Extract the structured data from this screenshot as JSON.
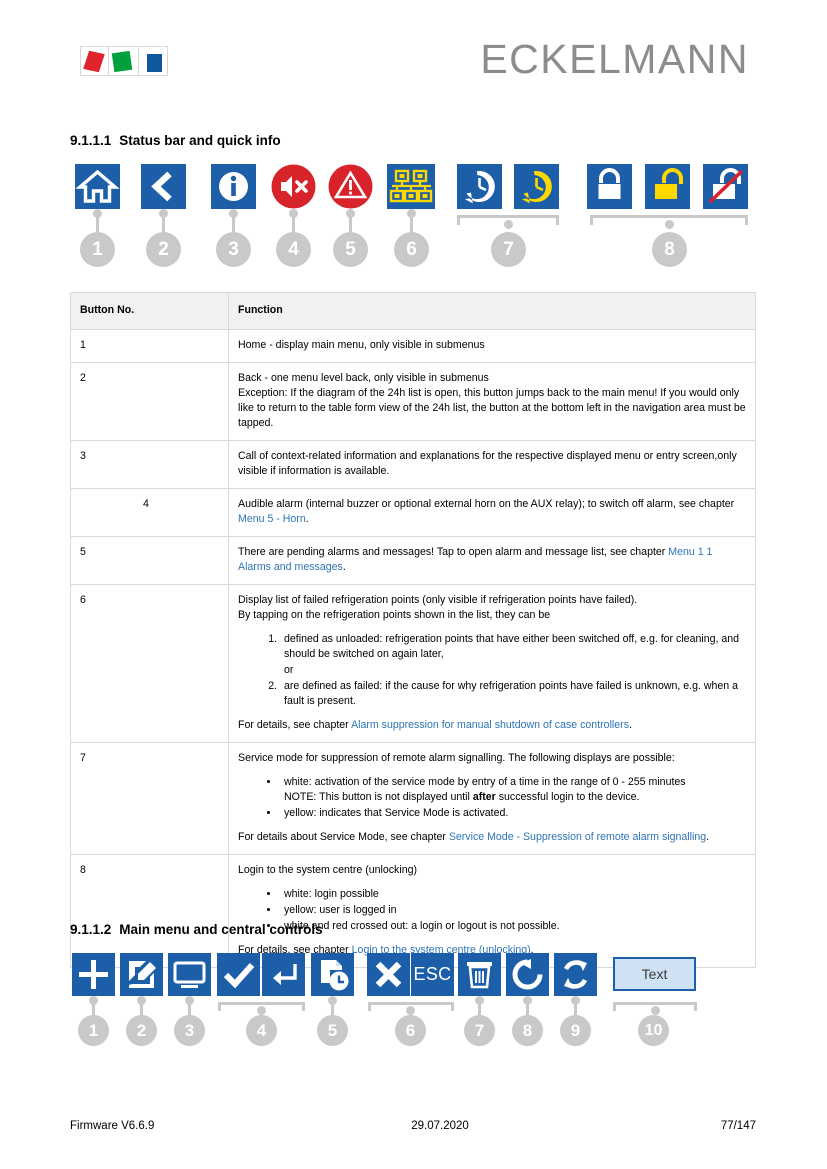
{
  "header": {
    "brand": "ECKELMANN",
    "logo_name": "eckelmann-logo"
  },
  "sections": [
    {
      "number": "9.1.1.1",
      "title": "Status bar and quick info"
    },
    {
      "number": "9.1.1.2",
      "title": "Main menu and central controls"
    }
  ],
  "status_bar_icons": [
    {
      "callout": "1",
      "icon": "home-icon",
      "tint": "#ffffff",
      "bg": "#1c5fa8"
    },
    {
      "callout": "2",
      "icon": "chevron-left-icon",
      "tint": "#ffffff",
      "bg": "#1c5fa8"
    },
    {
      "callout": "3",
      "icon": "info-icon",
      "tint": "#ffffff",
      "bg": "#1c5fa8"
    },
    {
      "callout": "4",
      "icon": "speaker-mute-icon",
      "tint": "#ffffff",
      "bg": "#d8232a"
    },
    {
      "callout": "5",
      "icon": "warning-triangle-icon",
      "tint": "#ffffff",
      "bg": "#d8232a"
    },
    {
      "callout": "6",
      "icon": "network-tree-icon",
      "tint": "#ffd800",
      "bg": "#1c5fa8"
    },
    {
      "callout": "7",
      "icon": "service-mode-clock-icon-white",
      "tint": "#ffffff",
      "bg": "#1c5fa8"
    },
    {
      "callout": "7",
      "icon": "service-mode-clock-icon-yellow",
      "tint": "#ffd800",
      "bg": "#1c5fa8"
    },
    {
      "callout": "8",
      "icon": "lock-closed-icon-white",
      "tint": "#ffffff",
      "bg": "#1c5fa8"
    },
    {
      "callout": "8",
      "icon": "lock-open-icon-yellow",
      "tint": "#ffd800",
      "bg": "#1c5fa8"
    },
    {
      "callout": "8",
      "icon": "lock-crossed-out-icon",
      "tint": "#ffffff",
      "bg": "#1c5fa8"
    }
  ],
  "main_menu_icons": [
    {
      "callout": "1",
      "icon": "plus-icon"
    },
    {
      "callout": "2",
      "icon": "edit-pencil-icon"
    },
    {
      "callout": "3",
      "icon": "monitor-icon"
    },
    {
      "callout": "4",
      "icon": "check-icon"
    },
    {
      "callout": "4",
      "icon": "enter-return-icon"
    },
    {
      "callout": "5",
      "icon": "save-document-icon"
    },
    {
      "callout": "6",
      "icon": "close-x-icon"
    },
    {
      "callout": "6",
      "icon": "esc-label",
      "label": "ESC"
    },
    {
      "callout": "7",
      "icon": "trash-icon"
    },
    {
      "callout": "8",
      "icon": "refresh-icon"
    },
    {
      "callout": "9",
      "icon": "sync-icon"
    },
    {
      "callout": "10",
      "icon": "text-field",
      "label": "Text"
    }
  ],
  "table": {
    "columns": [
      "Button No.",
      "Function"
    ],
    "rows": [
      {
        "no": "1",
        "indent": false,
        "lines": [
          "Home - display main menu, only visible in submenus"
        ]
      },
      {
        "no": "2",
        "indent": false,
        "lines": [
          "Back - one menu level back, only visible in submenus",
          "Exception: If the diagram of the 24h list is open, this button jumps back to the main menu! If you would only like to return to the table form view of the 24h list, the button at the bottom left in the navigation area must be tapped."
        ]
      },
      {
        "no": "3",
        "indent": false,
        "lines": [
          "Call of context-related information and explanations for the respective displayed menu or entry screen,only visible if information is available."
        ]
      },
      {
        "no": "4",
        "indent": true,
        "text_before_link": "Audible alarm (internal buzzer or optional external horn on the AUX relay); to switch off alarm, see chapter ",
        "link": "Menu 5 - Horn",
        "text_after_link": "."
      },
      {
        "no": "5",
        "indent": false,
        "text_before_link": "There are pending alarms and messages! Tap to open alarm and message list, see chapter ",
        "link": "Menu 1 1 Alarms and messages",
        "text_after_link": "."
      },
      {
        "no": "6",
        "indent": false,
        "lines": [
          "Display list of failed refrigeration points (only visible if refrigeration points have failed).",
          "By tapping on the refrigeration points shown in the list, they can be"
        ],
        "ordered_list": [
          "defined as unloaded: refrigeration points that have either been switched off, e.g. for cleaning, and should be switched on again later,\nor",
          "are defined as failed: if the cause for why refrigeration points have failed is unknown, e.g. when a fault is present."
        ],
        "footer_before_link": "For details, see chapter ",
        "footer_link": "Alarm suppression for manual shutdown of case controllers",
        "footer_after_link": "."
      },
      {
        "no": "7",
        "indent": false,
        "lines": [
          "Service mode for suppression of remote alarm signalling. The following displays are possible:"
        ],
        "bullet_list": [
          "white: activation of the service mode by entry of a time in the range of 0 - 255 minutes\nNOTE: This button is not displayed until **after** successful login to the device.",
          "yellow: indicates that Service Mode is activated."
        ],
        "footer_before_link": "For details about Service Mode, see chapter ",
        "footer_link": "Service Mode - Suppression of remote alarm signalling",
        "footer_after_link": "."
      },
      {
        "no": "8",
        "indent": false,
        "lines": [
          "Login to the system centre (unlocking)"
        ],
        "bullet_list": [
          "white: login possible",
          "yellow: user is logged in",
          "white and red crossed out: a login or logout is not possible."
        ],
        "footer_before_link": "For details, see chapter ",
        "footer_link": "Login to the system centre (unlocking)",
        "footer_after_link": "."
      }
    ]
  },
  "footer": {
    "firmware": "Firmware V6.6.9",
    "date": "29.07.2020",
    "page": "77/147"
  },
  "colors": {
    "tile_blue": "#1c5fa8",
    "alarm_red": "#d8232a",
    "accent_yellow": "#ffd800",
    "callout_grey": "#c9c9c9",
    "link_blue": "#2e74b5",
    "brand_grey": "#8c8c8c"
  }
}
